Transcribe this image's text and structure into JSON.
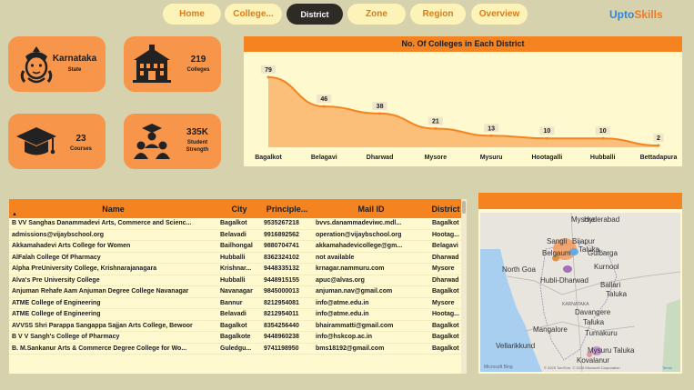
{
  "nav": {
    "home": "Home",
    "colleges": "College...",
    "district": "District",
    "zone": "Zone",
    "region": "Region",
    "overview": "Overview"
  },
  "brand": {
    "part1": "Upto",
    "part2": "Skills"
  },
  "kpis": {
    "state": {
      "value": "Karnataka",
      "label": "State"
    },
    "colleges": {
      "value": "219",
      "label": "Colleges"
    },
    "courses": {
      "value": "23",
      "label": "Courses"
    },
    "strength": {
      "value": "335K",
      "label1": "Student",
      "label2": "Strength"
    }
  },
  "chart_data": {
    "type": "area",
    "title": "No. Of Colleges in Each District",
    "categories": [
      "Bagalkot",
      "Belagavi",
      "Dharwad",
      "Mysore",
      "Mysuru",
      "Hootagalli",
      "Hubballi",
      "Bettadapura"
    ],
    "values": [
      79,
      46,
      38,
      21,
      13,
      10,
      10,
      2
    ],
    "data_labels": [
      "79",
      "46",
      "38",
      "21",
      "13",
      "10",
      "10",
      "2"
    ],
    "ylim": [
      0,
      85
    ],
    "colors": {
      "line": "#f5831f",
      "fill": "#fbbf79"
    }
  },
  "table": {
    "headers": [
      "Name",
      "City",
      "Principle...",
      "Mail ID",
      "District"
    ],
    "rows": [
      [
        "B VV Sanghas Danammadevi Arts, Commerce and Scienc...",
        "Bagalkot",
        "9535267218",
        "bvvs.danammadeviwc.mdl...",
        "Bagalkot"
      ],
      [
        "admissions@vijaybschool.org",
        "Belavadi",
        "9916892562",
        "operation@vijaybschool.org",
        "Hootag..."
      ],
      [
        "Akkamahadevi Arts College for Women",
        "Bailhongal",
        "9880704741",
        "akkamahadevicollege@gm...",
        "Belagavi"
      ],
      [
        "AlFalah College Of Pharmacy",
        "Hubballi",
        "8362324102",
        "not available",
        "Dharwad"
      ],
      [
        "Alpha PreUniversity College, Krishnarajanagara",
        "Krishnar...",
        "9448335132",
        "krnagar.nammuru.com",
        "Mysore"
      ],
      [
        "Alva's Pre University College",
        "Hubballi",
        "9448915155",
        "apuc@alvas.org",
        "Dharwad"
      ],
      [
        "Anjuman Rehafe Aam Anjuman Degree College Navanagar",
        "Navanagar",
        "9845000013",
        "anjuman.nav@gmail.com",
        "Bagalkot"
      ],
      [
        "ATME College of Engineering",
        "Bannur",
        "8212954081",
        "info@atme.edu.in",
        "Mysore"
      ],
      [
        "ATME College of Engineering",
        "Belavadi",
        "8212954011",
        "info@atme.edu.in",
        "Hootag..."
      ],
      [
        "AVVSS Shri Parappa Sangappa Sajjan Arts College, Bewoor",
        "Bagalkot",
        "8354256440",
        "bhairammatti@gmail.com",
        "Bagalkot"
      ],
      [
        "B V V Sangh's College of Pharmacy",
        "Bagalkote",
        "9448960238",
        "info@hskcop.ac.in",
        "Bagalkot"
      ],
      [
        "B. M.Sankanur Arts & Commerce Degree College for Wo...",
        "Guledgu...",
        "9741198950",
        "bms18192@gmail.com",
        "Bagalkot"
      ]
    ]
  },
  "map": {
    "labels": {
      "mysore": "Mysore",
      "hyderabad": "Hyderabad",
      "sangli": "Sangli",
      "bijapur": "Bijapur",
      "taluka": "Taluka",
      "belgaum": "Belgaum",
      "gulbarga": "Gulbarga",
      "north_goa": "North Goa",
      "kurnool": "Kurnool",
      "hubli": "Hubli-Dharwad",
      "ballari": "Ballari",
      "taluka2": "Taluka",
      "karnataka": "KARNATAKA",
      "davangere": "Davangere",
      "taluka3": "Taluka",
      "tumakuru": "Tumakuru",
      "mangalore": "Mangalore",
      "vellarikkund": "Vellarikkund",
      "mysuru": "Mysuru Taluka",
      "kovalanur": "Kovalanur"
    },
    "credit": "Microsoft Bing",
    "copyright": "© 2025 TomTom, © 2025 Microsoft Corporation",
    "terms": "Terms"
  }
}
